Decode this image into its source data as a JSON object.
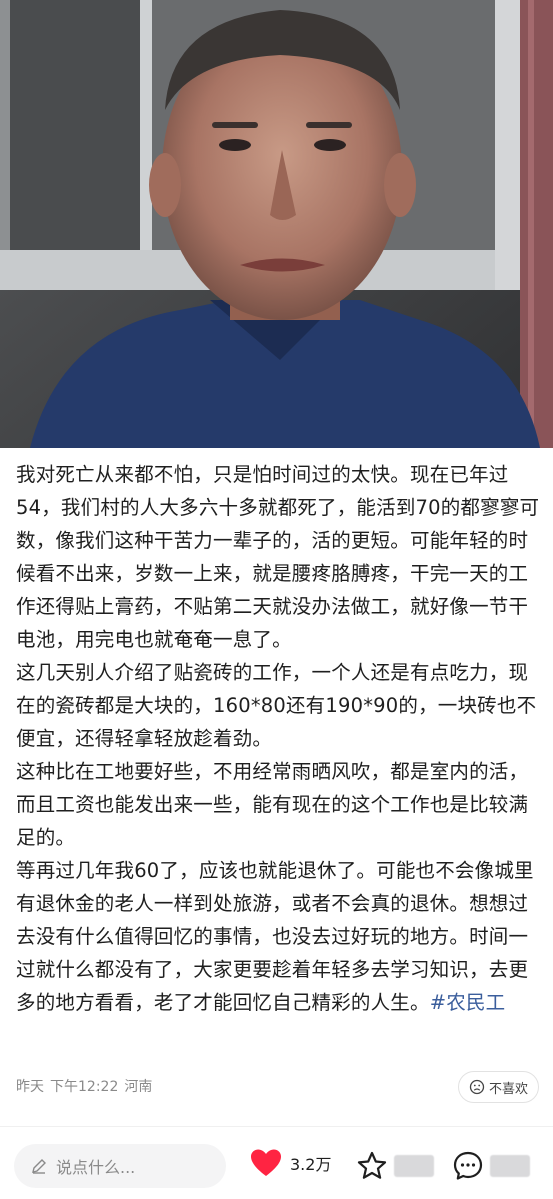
{
  "post": {
    "paragraphs": [
      "我对死亡从来都不怕，只是怕时间过的太快。现在已年过54，我们村的人大多六十多就都死了，能活到70的都寥寥可数，像我们这种干苦力一辈子的，活的更短。可能年轻的时候看不出来，岁数一上来，就是腰疼胳膊疼，干完一天的工作还得贴上膏药，不贴第二天就没办法做工，就好像一节干电池，用完电也就奄奄一息了。",
      "这几天别人介绍了贴瓷砖的工作，一个人还是有点吃力，现在的瓷砖都是大块的，160*80还有190*90的，一块砖也不便宜，还得轻拿轻放趁着劲。",
      "这种比在工地要好些，不用经常雨晒风吹，都是室内的活，而且工资也能发出来一些，能有现在的这个工作也是比较满足的。",
      "等再过几年我60了，应该也就能退休了。可能也不会像城里有退休金的老人一样到处旅游，或者不会真的退休。想想过去没有什么值得回忆的事情，也没去过好玩的地方。时间一过就什么都没有了，大家更要趁着年轻多去学习知识，去更多的地方看看，老了才能回忆自己精彩的人生。"
    ],
    "hashtag": "#农民工"
  },
  "meta": {
    "day": "昨天",
    "time": "下午12:22",
    "location": "河南",
    "dislike_label": "不喜欢"
  },
  "bottom_bar": {
    "comment_placeholder": "说点什么...",
    "like_count": "3.2万",
    "like_color": "#ff2442"
  },
  "icons": [
    "pencil-icon",
    "heart-icon",
    "star-icon",
    "comment-icon",
    "dislike-face-icon"
  ]
}
